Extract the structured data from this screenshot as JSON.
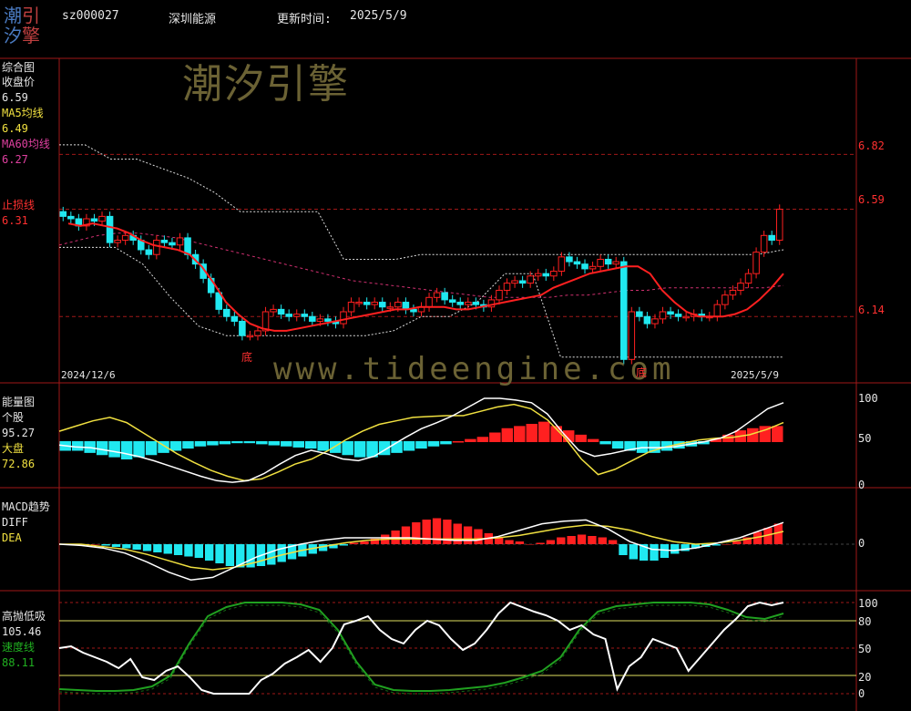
{
  "header": {
    "logo_chars": [
      "潮",
      "引",
      "汐",
      "擎"
    ],
    "code": "sz000027",
    "name": "深圳能源",
    "update_label": "更新时间:",
    "update_date": "2025/5/9"
  },
  "watermark": {
    "cn": "潮汐引擎",
    "url": "www.tideengine.com"
  },
  "panels": {
    "price": {
      "title": "综合图",
      "close_label": "收盘价",
      "close_value": "6.59",
      "ma5_label": "MA5均线",
      "ma5_value": "6.49",
      "ma60_label": "MA60均线",
      "ma60_value": "6.27",
      "stop_label": "止损线",
      "stop_value": "6.31",
      "right_ticks": [
        "6.82",
        "6.59",
        "6.14"
      ],
      "start_date": "2024/12/6",
      "end_date": "2025/5/9",
      "bottom_marks": [
        "底",
        "底"
      ]
    },
    "energy": {
      "title": "能量图",
      "stock_label": "个股",
      "stock_value": "95.27",
      "market_label": "大盘",
      "market_value": "72.86",
      "right_ticks": [
        "100",
        "50",
        "0"
      ]
    },
    "macd": {
      "title": "MACD趋势",
      "diff_label": "DIFF",
      "dea_label": "DEA",
      "right_ticks": [
        "0"
      ]
    },
    "osc": {
      "title": "高抛低吸",
      "value": "105.46",
      "speed_label": "速度线",
      "speed_value": "88.11",
      "right_ticks": [
        "100",
        "80",
        "50",
        "20",
        "0"
      ]
    }
  },
  "colors": {
    "up": "#ff2020",
    "down": "#20e8f0",
    "ma5": "#ff2020",
    "ma60": "#d03070",
    "white": "#ffffff",
    "yellow": "#f0e040",
    "green": "#20a020",
    "grid": "#a01818"
  },
  "chart_data": [
    {
      "type": "candlestick",
      "title": "综合图",
      "x_start": "2024/12/6",
      "x_end": "2025/5/9",
      "ylim": [
        5.9,
        7.2
      ],
      "reference_levels": [
        6.82,
        6.59,
        6.14
      ],
      "close": [
        6.56,
        6.55,
        6.52,
        6.55,
        6.54,
        6.56,
        6.45,
        6.46,
        6.48,
        6.46,
        6.42,
        6.4,
        6.46,
        6.45,
        6.44,
        6.47,
        6.4,
        6.36,
        6.3,
        6.24,
        6.17,
        6.14,
        6.12,
        6.06,
        6.06,
        6.08,
        6.16,
        6.17,
        6.15,
        6.14,
        6.15,
        6.14,
        6.12,
        6.13,
        6.12,
        6.11,
        6.16,
        6.2,
        6.2,
        6.19,
        6.2,
        6.18,
        6.18,
        6.2,
        6.17,
        6.16,
        6.18,
        6.22,
        6.24,
        6.21,
        6.2,
        6.19,
        6.2,
        6.19,
        6.18,
        6.21,
        6.25,
        6.28,
        6.29,
        6.28,
        6.31,
        6.32,
        6.31,
        6.33,
        6.39,
        6.37,
        6.36,
        6.34,
        6.35,
        6.38,
        6.36,
        6.37,
        5.96,
        6.16,
        6.14,
        6.11,
        6.13,
        6.16,
        6.15,
        6.14,
        6.14,
        6.15,
        6.14,
        6.14,
        6.19,
        6.23,
        6.25,
        6.28,
        6.32,
        6.41,
        6.48,
        6.46,
        6.59
      ],
      "ma5": [
        6.53,
        6.52,
        6.53,
        6.52,
        6.51,
        6.49,
        6.46,
        6.44,
        6.43,
        6.42,
        6.4,
        6.35,
        6.28,
        6.2,
        6.15,
        6.11,
        6.09,
        6.08,
        6.08,
        6.09,
        6.1,
        6.11,
        6.12,
        6.13,
        6.14,
        6.15,
        6.16,
        6.17,
        6.17,
        6.18,
        6.18,
        6.18,
        6.17,
        6.17,
        6.18,
        6.19,
        6.2,
        6.21,
        6.22,
        6.23,
        6.26,
        6.28,
        6.3,
        6.32,
        6.33,
        6.34,
        6.35,
        6.35,
        6.32,
        6.25,
        6.2,
        6.16,
        6.14,
        6.14,
        6.14,
        6.15,
        6.17,
        6.21,
        6.26,
        6.32
      ],
      "ma60": [
        6.44,
        6.46,
        6.48,
        6.49,
        6.49,
        6.48,
        6.47,
        6.45,
        6.43,
        6.41,
        6.39,
        6.37,
        6.35,
        6.33,
        6.31,
        6.29,
        6.28,
        6.27,
        6.26,
        6.25,
        6.24,
        6.23,
        6.22,
        6.22,
        6.22,
        6.22,
        6.23,
        6.23,
        6.24,
        6.25,
        6.25,
        6.26,
        6.26,
        6.26,
        6.26,
        6.26,
        6.26,
        6.27
      ],
      "stop_upper": [
        6.86,
        6.86,
        6.8,
        6.8,
        6.76,
        6.72,
        6.66,
        6.58,
        6.58,
        6.58,
        6.58,
        6.38,
        6.38,
        6.38,
        6.4,
        6.4,
        6.4,
        6.4,
        6.4,
        6.4,
        6.4,
        6.4,
        6.4,
        6.4,
        6.4,
        6.4,
        6.4,
        6.4,
        6.42
      ],
      "stop_lower": [
        6.43,
        6.43,
        6.43,
        6.36,
        6.22,
        6.1,
        6.06,
        6.06,
        6.06,
        6.06,
        6.06,
        6.06,
        6.08,
        6.14,
        6.14,
        6.2,
        6.32,
        6.32,
        5.97,
        5.97,
        5.97,
        5.97,
        5.97,
        5.97,
        5.97,
        5.97,
        5.97
      ]
    },
    {
      "type": "bar+line",
      "title": "能量图",
      "ylim": [
        0,
        100
      ],
      "series": [
        {
          "name": "个股",
          "values": [
            46,
            44,
            43,
            40,
            37,
            33,
            28,
            22,
            16,
            10,
            5,
            3,
            5,
            13,
            24,
            34,
            40,
            36,
            30,
            28,
            33,
            44,
            55,
            65,
            72,
            80,
            90,
            100,
            100,
            98,
            95,
            82,
            60,
            40,
            33,
            36,
            40,
            43,
            43,
            44,
            47,
            50,
            54,
            62,
            75,
            88,
            95
          ]
        },
        {
          "name": "大盘",
          "values": [
            62,
            68,
            74,
            78,
            72,
            60,
            48,
            36,
            26,
            17,
            10,
            5,
            7,
            15,
            24,
            30,
            40,
            52,
            62,
            70,
            74,
            78,
            79,
            80,
            80,
            85,
            90,
            93,
            88,
            75,
            55,
            30,
            12,
            18,
            28,
            38,
            44,
            48,
            52,
            54,
            55,
            58,
            64,
            72
          ]
        }
      ],
      "bars": [
        -8,
        -8,
        -10,
        -12,
        -14,
        -16,
        -14,
        -12,
        -10,
        -8,
        -6,
        -4,
        -3,
        -2,
        -1,
        -1,
        -2,
        -3,
        -4,
        -5,
        -6,
        -8,
        -10,
        -12,
        -14,
        -14,
        -12,
        -10,
        -8,
        -6,
        -4,
        -2,
        0,
        2,
        4,
        8,
        12,
        14,
        16,
        18,
        14,
        10,
        6,
        2,
        -2,
        -6,
        -8,
        -10,
        -10,
        -8,
        -6,
        -4,
        -2,
        2,
        6,
        10,
        12,
        14,
        14
      ]
    },
    {
      "type": "bar+line",
      "title": "MACD趋势",
      "series": [
        {
          "name": "DIFF",
          "values": [
            0,
            -0.01,
            -0.03,
            -0.07,
            -0.14,
            -0.22,
            -0.28,
            -0.26,
            -0.18,
            -0.1,
            -0.04,
            0,
            0.03,
            0.05,
            0.05,
            0.05,
            0.05,
            0.04,
            0.03,
            0.03,
            0.06,
            0.11,
            0.16,
            0.18,
            0.19,
            0.12,
            0.02,
            -0.04,
            -0.05,
            -0.03,
            0.01,
            0.05,
            0.11,
            0.17
          ]
        },
        {
          "name": "DEA",
          "values": [
            0,
            0,
            -0.02,
            -0.04,
            -0.08,
            -0.13,
            -0.18,
            -0.2,
            -0.18,
            -0.14,
            -0.09,
            -0.05,
            -0.02,
            0.01,
            0.03,
            0.04,
            0.04,
            0.04,
            0.04,
            0.04,
            0.05,
            0.07,
            0.1,
            0.13,
            0.15,
            0.14,
            0.11,
            0.06,
            0.02,
            0,
            0.01,
            0.03,
            0.06,
            0.1
          ]
        }
      ],
      "bars": [
        0,
        0,
        0,
        0,
        -0.01,
        -0.02,
        -0.03,
        -0.04,
        -0.05,
        -0.06,
        -0.07,
        -0.08,
        -0.09,
        -0.1,
        -0.12,
        -0.14,
        -0.16,
        -0.17,
        -0.17,
        -0.16,
        -0.15,
        -0.13,
        -0.11,
        -0.09,
        -0.07,
        -0.05,
        -0.03,
        -0.01,
        0.01,
        0.02,
        0.04,
        0.07,
        0.1,
        0.13,
        0.16,
        0.18,
        0.19,
        0.18,
        0.15,
        0.13,
        0.11,
        0.08,
        0.05,
        0.03,
        0.02,
        0,
        0.01,
        0.03,
        0.05,
        0.06,
        0.07,
        0.06,
        0.05,
        0.03,
        -0.08,
        -0.11,
        -0.12,
        -0.12,
        -0.1,
        -0.07,
        -0.05,
        -0.03,
        -0.02,
        -0.01,
        0,
        0.02,
        0.05,
        0.09,
        0.12,
        0.15
      ]
    },
    {
      "type": "line",
      "title": "高抛低吸",
      "ylim": [
        0,
        100
      ],
      "reference_levels": [
        100,
        80,
        50,
        20,
        0
      ],
      "series": [
        {
          "name": "高抛低吸",
          "values": [
            50,
            52,
            45,
            40,
            35,
            28,
            38,
            18,
            15,
            25,
            30,
            18,
            4,
            0,
            0,
            0,
            0,
            15,
            22,
            33,
            40,
            48,
            35,
            50,
            76,
            80,
            85,
            70,
            60,
            55,
            70,
            80,
            75,
            60,
            48,
            55,
            70,
            88,
            100,
            95,
            90,
            86,
            80,
            70,
            75,
            65,
            60,
            5,
            30,
            40,
            60,
            55,
            50,
            25,
            40,
            55,
            70,
            82,
            96,
            100,
            97,
            100
          ]
        },
        {
          "name": "速度线",
          "values": [
            5,
            4,
            3,
            3,
            4,
            8,
            20,
            55,
            85,
            95,
            100,
            100,
            100,
            98,
            92,
            70,
            35,
            10,
            4,
            3,
            3,
            4,
            6,
            8,
            12,
            18,
            25,
            40,
            70,
            90,
            96,
            98,
            100,
            100,
            100,
            98,
            92,
            84,
            82,
            88
          ]
        }
      ]
    }
  ]
}
